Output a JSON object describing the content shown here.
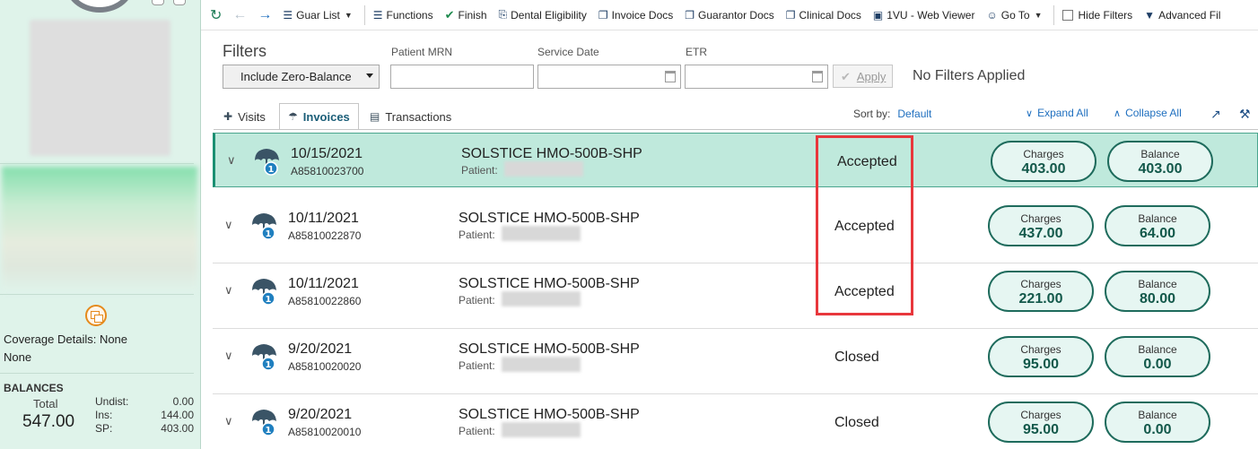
{
  "sidebar": {
    "coverage_label": "Coverage Details: None",
    "coverage_value": "None",
    "balances_heading": "BALANCES",
    "total_label": "Total",
    "total_value": "547.00",
    "undist_label": "Undist:",
    "undist_value": "0.00",
    "ins_label": "Ins:",
    "ins_value": "144.00",
    "sp_label": "SP:",
    "sp_value": "403.00"
  },
  "toolbar": {
    "refresh_icon": "refresh-icon",
    "back_icon": "arrow-left-icon",
    "forward_icon": "arrow-right-icon",
    "guar_list": "Guar List",
    "functions": "Functions",
    "finish": "Finish",
    "dental_eligibility": "Dental Eligibility",
    "invoice_docs": "Invoice Docs",
    "guarantor_docs": "Guarantor Docs",
    "clinical_docs": "Clinical Docs",
    "web_viewer": "1VU - Web Viewer",
    "go_to": "Go To",
    "hide_filters": "Hide Filters",
    "advanced_filters": "Advanced Fil"
  },
  "filters": {
    "title": "Filters",
    "zero_balance_select": "Include Zero-Balance",
    "mrn_label": "Patient MRN",
    "mrn_value": "",
    "service_date_label": "Service Date",
    "service_date_value": "",
    "etr_label": "ETR",
    "etr_value": "",
    "apply_label": "Apply",
    "status": "No Filters Applied"
  },
  "tabs": [
    {
      "label": "Visits",
      "icon": "medical-bag-icon"
    },
    {
      "label": "Invoices",
      "icon": "umbrella-icon"
    },
    {
      "label": "Transactions",
      "icon": "money-icon"
    }
  ],
  "sort": {
    "label": "Sort by:",
    "value": "Default"
  },
  "actions": {
    "expand_all": "Expand All",
    "collapse_all": "Collapse All"
  },
  "invoices": [
    {
      "date": "10/15/2021",
      "number": "A85810023700",
      "plan": "SOLSTICE HMO-500B-SHP",
      "patient_label": "Patient:",
      "status": "Accepted",
      "charges_label": "Charges",
      "charges": "403.00",
      "balance_label": "Balance",
      "balance": "403.00"
    },
    {
      "date": "10/11/2021",
      "number": "A85810022870",
      "plan": "SOLSTICE HMO-500B-SHP",
      "patient_label": "Patient:",
      "status": "Accepted",
      "charges_label": "Charges",
      "charges": "437.00",
      "balance_label": "Balance",
      "balance": "64.00"
    },
    {
      "date": "10/11/2021",
      "number": "A85810022860",
      "plan": "SOLSTICE HMO-500B-SHP",
      "patient_label": "Patient:",
      "status": "Accepted",
      "charges_label": "Charges",
      "charges": "221.00",
      "balance_label": "Balance",
      "balance": "80.00"
    },
    {
      "date": "9/20/2021",
      "number": "A85810020020",
      "plan": "SOLSTICE HMO-500B-SHP",
      "patient_label": "Patient:",
      "status": "Closed",
      "charges_label": "Charges",
      "charges": "95.00",
      "balance_label": "Balance",
      "balance": "0.00"
    },
    {
      "date": "9/20/2021",
      "number": "A85810020010",
      "plan": "SOLSTICE HMO-500B-SHP",
      "patient_label": "Patient:",
      "status": "Closed",
      "charges_label": "Charges",
      "charges": "95.00",
      "balance_label": "Balance",
      "balance": "0.00"
    }
  ],
  "colors": {
    "accent": "#1e6b5c",
    "selected_row": "#bfe9dc",
    "highlight": "#e8373c",
    "link": "#1f6fbf"
  }
}
